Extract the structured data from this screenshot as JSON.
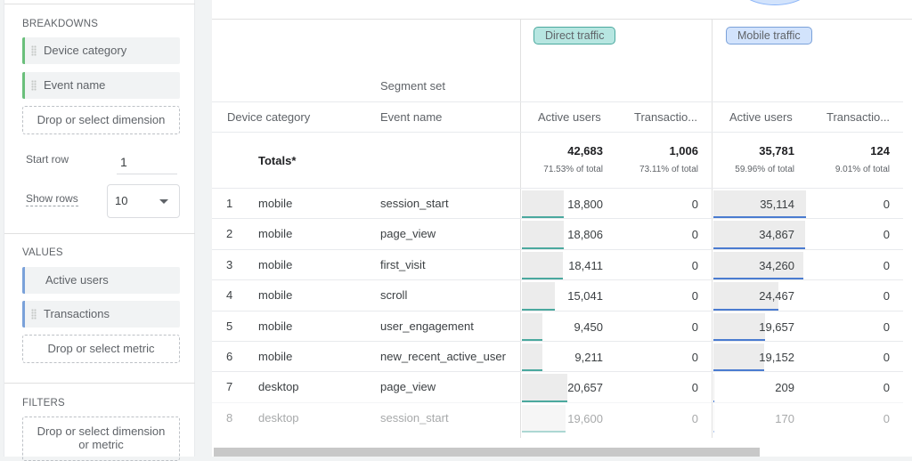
{
  "sidebar": {
    "breakdowns": {
      "title": "BREAKDOWNS",
      "items": [
        "Device category",
        "Event name"
      ],
      "drop_label": "Drop or select dimension"
    },
    "start_row": {
      "label": "Start row",
      "value": "1"
    },
    "show_rows": {
      "label": "Show rows",
      "value": "10"
    },
    "values": {
      "title": "VALUES",
      "items": [
        "Active users",
        "Transactions"
      ],
      "drop_label": "Drop or select metric"
    },
    "filters": {
      "title": "FILTERS",
      "drop_label": "Drop or select dimension or metric"
    }
  },
  "table": {
    "segment_set_label": "Segment set",
    "segments": [
      {
        "name": "Direct traffic",
        "color": "#4aa89e"
      },
      {
        "name": "Mobile traffic",
        "color": "#4a7bd0"
      }
    ],
    "columns": [
      "Device category",
      "Event name",
      "Active users",
      "Transactio...",
      "Active users",
      "Transactio..."
    ],
    "totals": {
      "label": "Totals*",
      "values": [
        "42,683",
        "1,006",
        "35,781",
        "124"
      ],
      "pcts": [
        "71.53% of total",
        "73.11% of total",
        "59.96% of total",
        "9.01% of total"
      ]
    },
    "rows": [
      {
        "n": "1",
        "device": "mobile",
        "event": "session_start",
        "d_users": "18,800",
        "d_tx": "0",
        "m_users": "35,114",
        "m_tx": "0",
        "d_frac": 0.44,
        "m_frac": 0.981
      },
      {
        "n": "2",
        "device": "mobile",
        "event": "page_view",
        "d_users": "18,806",
        "d_tx": "0",
        "m_users": "34,867",
        "m_tx": "0",
        "d_frac": 0.441,
        "m_frac": 0.974
      },
      {
        "n": "3",
        "device": "mobile",
        "event": "first_visit",
        "d_users": "18,411",
        "d_tx": "0",
        "m_users": "34,260",
        "m_tx": "0",
        "d_frac": 0.431,
        "m_frac": 0.957
      },
      {
        "n": "4",
        "device": "mobile",
        "event": "scroll",
        "d_users": "15,041",
        "d_tx": "0",
        "m_users": "24,467",
        "m_tx": "0",
        "d_frac": 0.352,
        "m_frac": 0.684
      },
      {
        "n": "5",
        "device": "mobile",
        "event": "user_engagement",
        "d_users": "9,450",
        "d_tx": "0",
        "m_users": "19,657",
        "m_tx": "0",
        "d_frac": 0.221,
        "m_frac": 0.549
      },
      {
        "n": "6",
        "device": "mobile",
        "event": "new_recent_active_user",
        "d_users": "9,211",
        "d_tx": "0",
        "m_users": "19,152",
        "m_tx": "0",
        "d_frac": 0.216,
        "m_frac": 0.535
      },
      {
        "n": "7",
        "device": "desktop",
        "event": "page_view",
        "d_users": "20,657",
        "d_tx": "0",
        "m_users": "209",
        "m_tx": "0",
        "d_frac": 0.484,
        "m_frac": 0.006
      },
      {
        "n": "8",
        "device": "desktop",
        "event": "session_start",
        "d_users": "19,600",
        "d_tx": "0",
        "m_users": "170",
        "m_tx": "0",
        "d_frac": 0.459,
        "m_frac": 0.005
      }
    ]
  }
}
